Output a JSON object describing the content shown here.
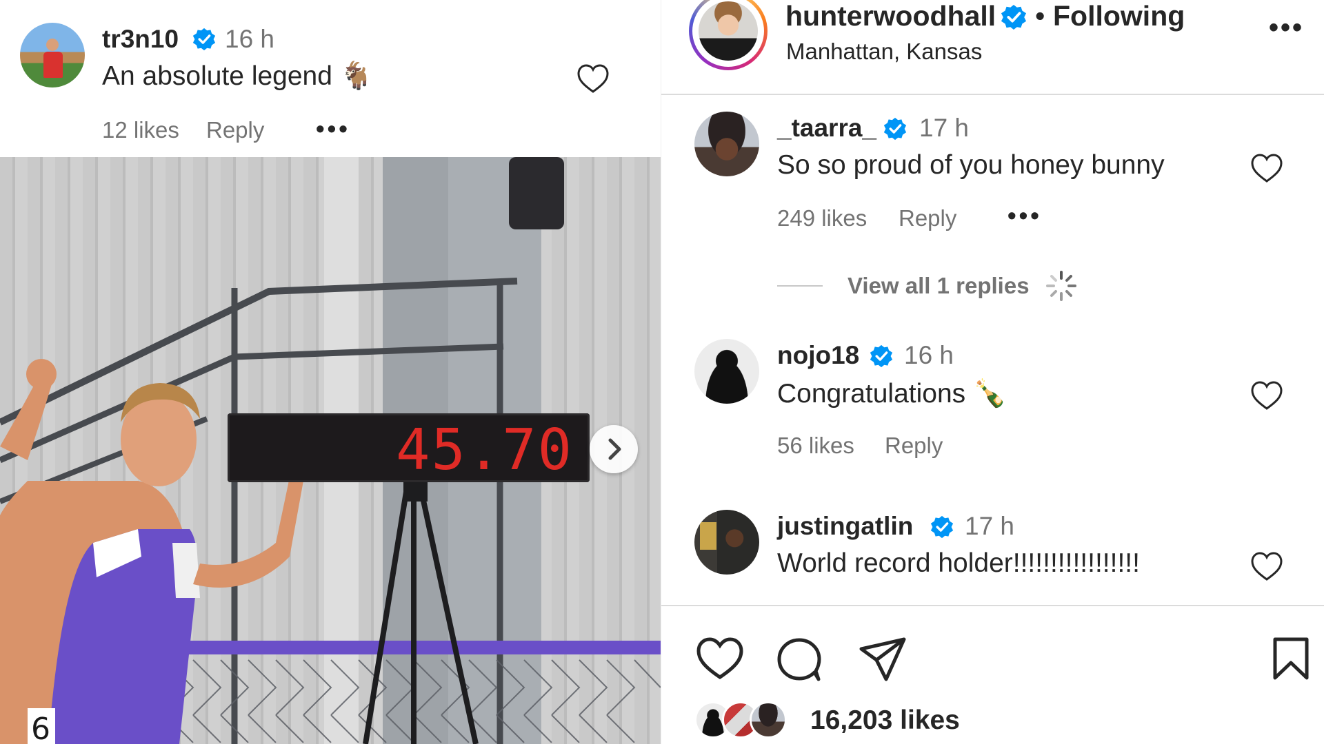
{
  "left_comment": {
    "username": "tr3n10",
    "time": "16 h",
    "text": "An absolute legend 🐐",
    "likes": "12 likes",
    "reply_label": "Reply",
    "more": "•••"
  },
  "photo": {
    "scoreboard_value": "45.70",
    "bib_number": "6"
  },
  "header": {
    "username": "hunterwoodhall",
    "separator": "•",
    "follow_label": "Following",
    "location": "Manhattan, Kansas",
    "more": "•••"
  },
  "comments": [
    {
      "username": "_taarra_",
      "time": "17 h",
      "text": "So so proud of you honey bunny",
      "likes": "249 likes",
      "reply_label": "Reply",
      "more": "•••",
      "view_replies": "View all 1 replies"
    },
    {
      "username": "nojo18",
      "time": "16 h",
      "text": "Congratulations 🍾",
      "likes": "56 likes",
      "reply_label": "Reply"
    },
    {
      "username": "justingatlin",
      "time": "17 h",
      "text": "World record holder!!!!!!!!!!!!!!!!!"
    }
  ],
  "post_stats": {
    "likes": "16,203 likes"
  },
  "colors": {
    "verified_blue": "#0095f6",
    "text_primary": "#262626",
    "text_secondary": "#737373",
    "scoreboard_red": "#e02b26"
  }
}
